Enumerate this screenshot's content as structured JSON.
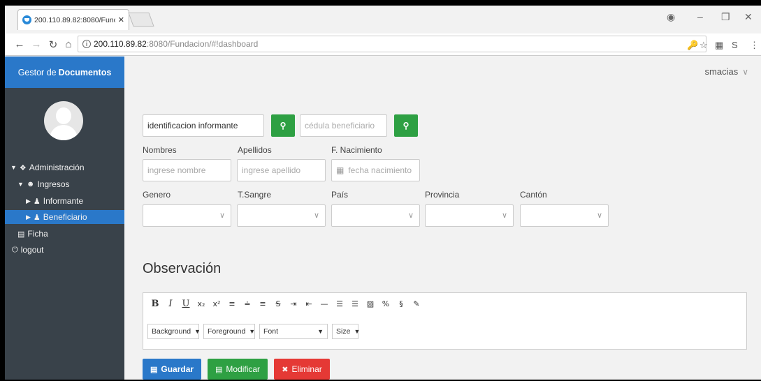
{
  "browser": {
    "tab_title": "200.110.89.82:8080/Func",
    "url_host": "200.110.89.82",
    "url_path": ":8080/Fundacion/#!dashboard"
  },
  "app": {
    "brand_prefix": "Gestor de",
    "brand_bold": "Documentos",
    "user": "smacias"
  },
  "sidebar": {
    "items": [
      {
        "label": "Administración"
      },
      {
        "label": "Ingresos"
      },
      {
        "label": "Informante"
      },
      {
        "label": "Beneficiario"
      },
      {
        "label": "Ficha"
      },
      {
        "label": "logout"
      }
    ]
  },
  "form": {
    "search1_placeholder": "identificacion informante",
    "search2_placeholder": "cédula beneficiario",
    "labels": {
      "nombres": "Nombres",
      "apellidos": "Apellidos",
      "nacimiento": "F. Nacimiento",
      "genero": "Genero",
      "sangre": "T.Sangre",
      "pais": "País",
      "provincia": "Provincia",
      "canton": "Cantón"
    },
    "placeholders": {
      "nombre": "ingrese nombre",
      "apellido": "ingrese apellido",
      "fecha": "fecha nacimiento"
    },
    "observacion_title": "Observación"
  },
  "editor": {
    "dropdowns": [
      "Background",
      "Foreground",
      "Font",
      "Size"
    ]
  },
  "actions": {
    "guardar": "Guardar",
    "modificar": "Modificar",
    "eliminar": "Eliminar"
  },
  "colors": {
    "primary": "#2a78c9",
    "success": "#2ea043",
    "danger": "#e53935",
    "sidebar": "#39424a"
  }
}
